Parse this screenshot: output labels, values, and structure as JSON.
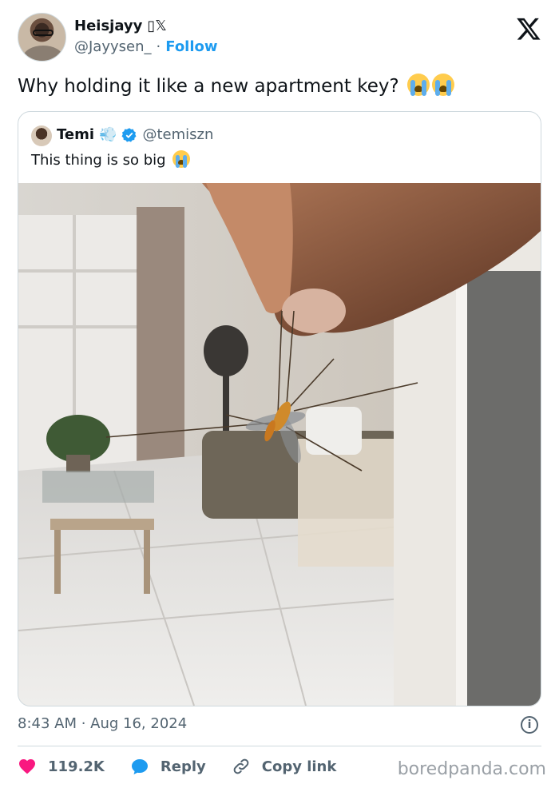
{
  "author": {
    "display_name": "Heisjayy",
    "name_suffix": "▯𝕏",
    "handle": "@Jayysen_",
    "separator": "·",
    "follow_label": "Follow"
  },
  "tweet": {
    "text": "Why holding it like a new apartment key?",
    "emoji": "loudly-crying-face-emoji",
    "emoji_count": 2
  },
  "quoted_tweet": {
    "display_name": "Temi",
    "name_emoji": "dash-emoji",
    "verified": true,
    "handle": "@temiszn",
    "text": "This thing is so big",
    "emoji": "loudly-crying-face-emoji",
    "media": "photo of a hand holding a crane fly in a living room"
  },
  "meta": {
    "timestamp": "8:43 AM · Aug 16, 2024"
  },
  "actions": {
    "likes": "119.2K",
    "reply_label": "Reply",
    "copy_link_label": "Copy link"
  },
  "watermark": "boredpanda.com",
  "colors": {
    "accent": "#1d9bf0",
    "like": "#f91880",
    "secondary_text": "#536471",
    "border": "#cfd9de"
  },
  "icons": [
    "x-logo-icon",
    "verified-badge-icon",
    "info-icon",
    "heart-icon",
    "reply-icon",
    "link-icon"
  ]
}
